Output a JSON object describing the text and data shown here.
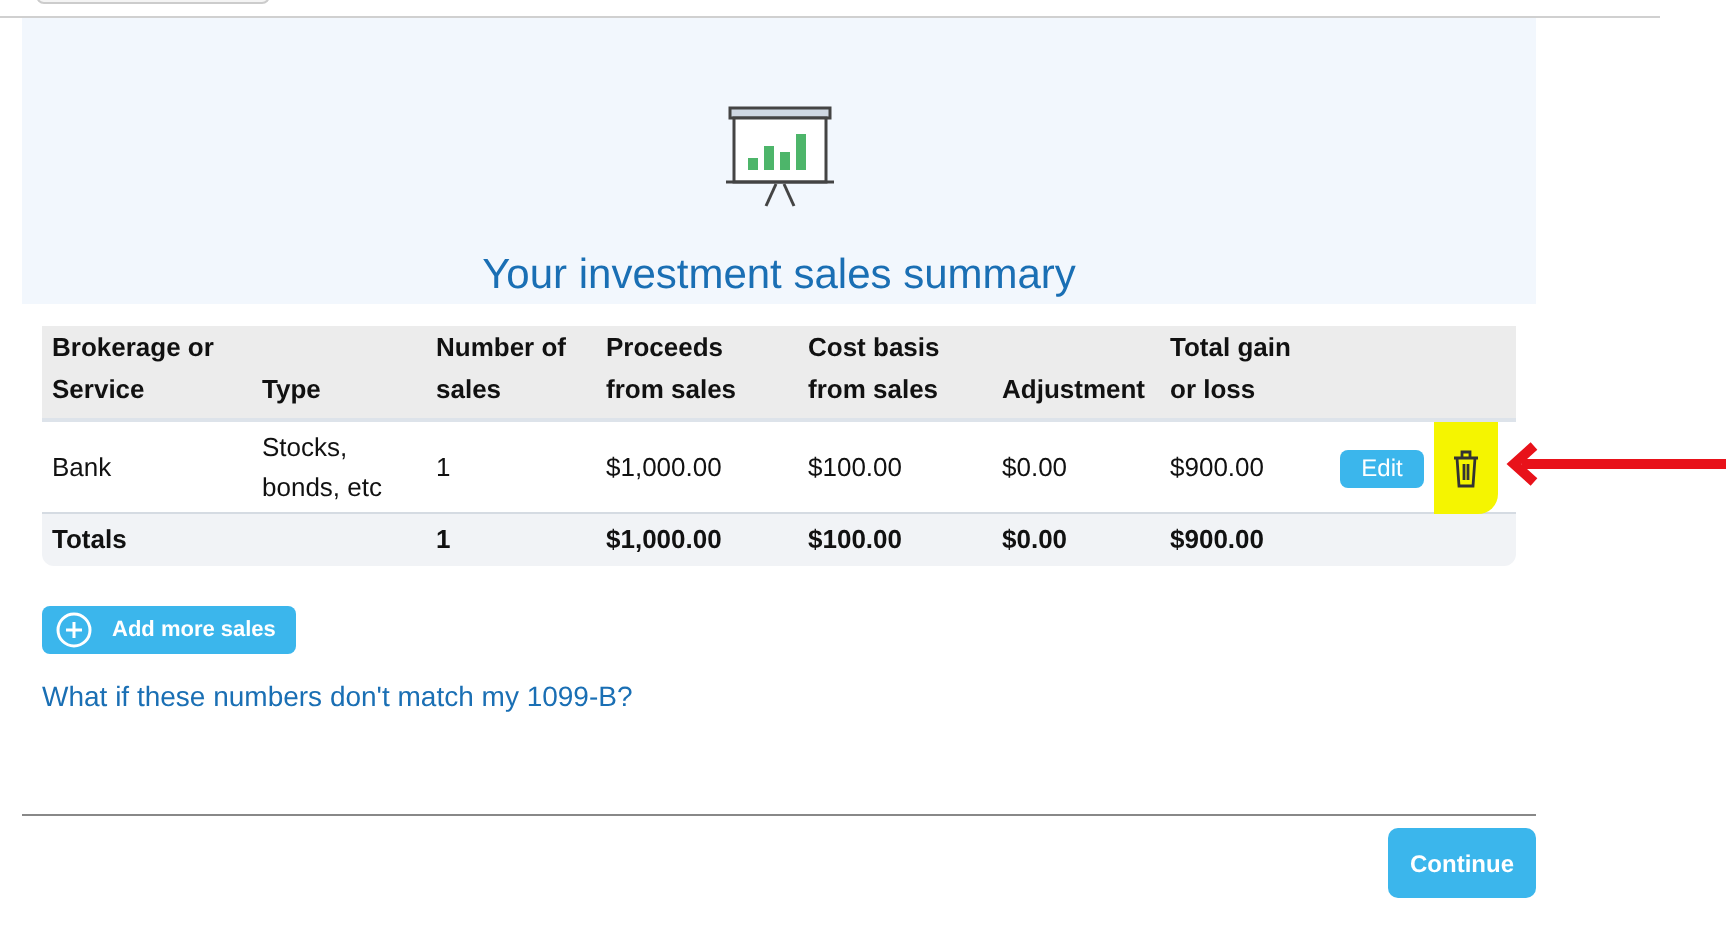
{
  "title": "Your investment sales summary",
  "table": {
    "columns": [
      "Brokerage or Service",
      "Type",
      "Number of sales",
      "Proceeds from sales",
      "Cost basis from sales",
      "Adjustment",
      "Total gain or loss"
    ],
    "rows": [
      {
        "cells": [
          "Bank",
          "Stocks, bonds, etc",
          "1",
          "$1,000.00",
          "$100.00",
          "$0.00",
          "$900.00"
        ],
        "edit_label": "Edit",
        "delete_highlighted": true
      }
    ],
    "totals": {
      "label": "Totals",
      "cells": [
        "1",
        "$1,000.00",
        "$100.00",
        "$0.00",
        "$900.00"
      ]
    }
  },
  "add_button": "Add more sales",
  "help_link": "What if these numbers don't match my 1099-B?",
  "continue_button": "Continue"
}
